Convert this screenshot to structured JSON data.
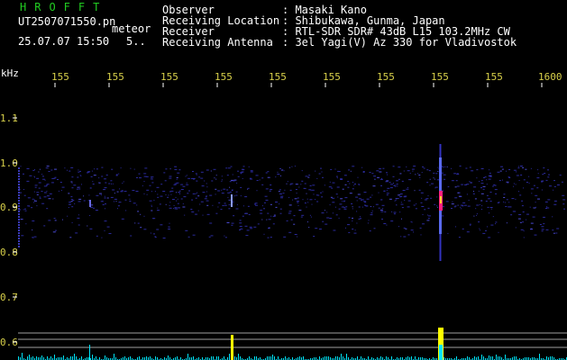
{
  "header": {
    "app_title": "HROFFT",
    "filename": "UT2507071550.pn",
    "meteor_label": "meteor",
    "datetime": "25.07.07 15:50",
    "count": "5.."
  },
  "info": [
    {
      "label": "Observer",
      "value": ": Masaki Kano"
    },
    {
      "label": "Receiving Location",
      "value": ": Shibukawa, Gunma, Japan"
    },
    {
      "label": "Receiver",
      "value": ": RTL-SDR SDR# 43dB L15 103.2MHz CW"
    },
    {
      "label": "Receiving Antenna",
      "value": ": 3el Yagi(V) Az 330 for Vladivostok"
    }
  ],
  "axes": {
    "y_unit": "kHz",
    "x_ticks": [
      "155",
      "155",
      "155",
      "155",
      "155",
      "155",
      "155",
      "155",
      "155",
      "1600"
    ],
    "y_ticks": [
      "1.1",
      "1.0",
      "0.9",
      "0.8",
      "0.7",
      "0.6"
    ]
  },
  "colors": {
    "background": "#000000",
    "tick_text": "#d8d04a",
    "title_green": "#22cc22",
    "noise_blue": "#2a2a9a",
    "spectrum_cyan": "#00e5ff",
    "peak_yellow": "#ffff00"
  },
  "spectrogram": {
    "band_center_khz": 0.92,
    "strong_echo_minute": 1558,
    "minor_echo_minute": 1554
  }
}
